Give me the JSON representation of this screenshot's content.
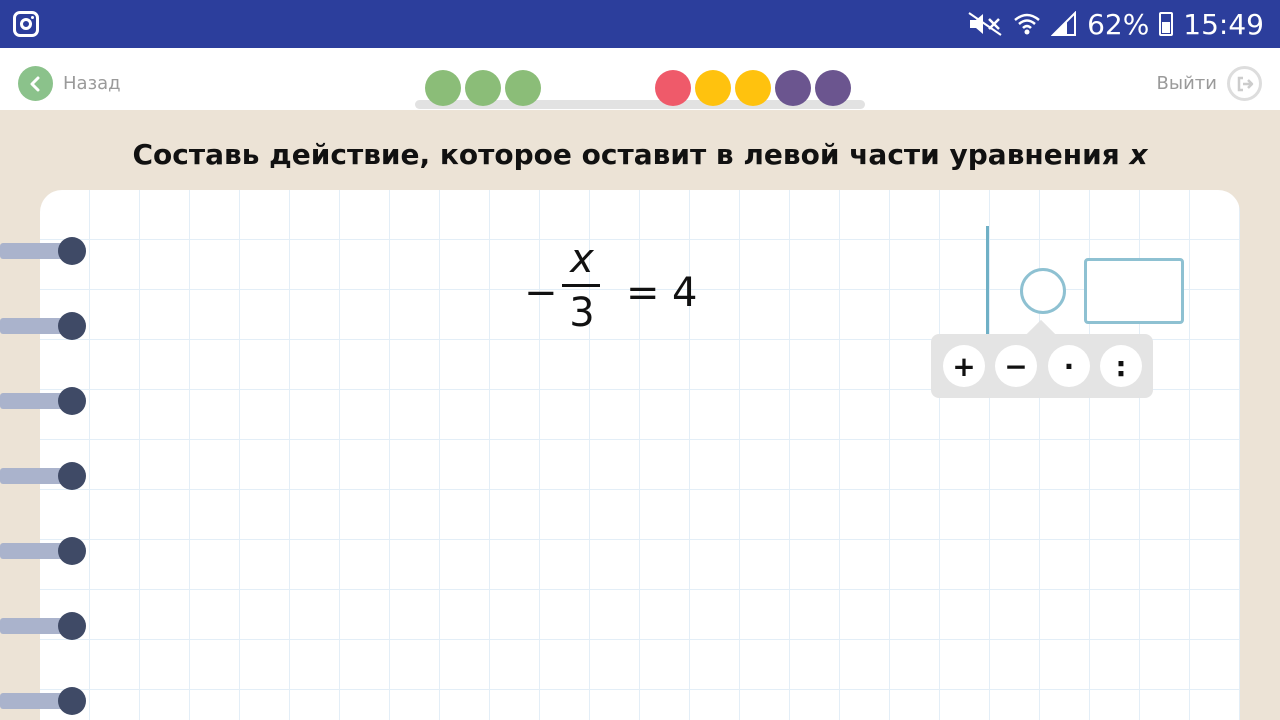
{
  "status_bar": {
    "battery_text": "62%",
    "time": "15:49",
    "icons": [
      "instagram-icon",
      "mute-icon",
      "wifi-icon",
      "signal-icon",
      "battery-icon"
    ]
  },
  "header": {
    "back_label": "Назад",
    "exit_label": "Выйти"
  },
  "progress": {
    "dots": [
      {
        "status": "done",
        "color": "#8bbd78"
      },
      {
        "status": "done",
        "color": "#8bbd78"
      },
      {
        "status": "done",
        "color": "#8bbd78"
      },
      {
        "status": "current",
        "color": "#ef5a6a"
      },
      {
        "status": "pending",
        "color": "#ffc20e"
      },
      {
        "status": "pending",
        "color": "#ffc20e"
      },
      {
        "status": "pending",
        "color": "#6b558f"
      },
      {
        "status": "pending",
        "color": "#6b558f"
      }
    ]
  },
  "task": {
    "title": "Составь действие, которое оставит в левой части уравнения",
    "title_var": "x"
  },
  "equation": {
    "sign": "−",
    "numerator": "x",
    "denominator": "3",
    "equals": "=",
    "rhs": "4"
  },
  "operations": {
    "plus": "+",
    "minus": "−",
    "multiply": "·",
    "divide": ":"
  },
  "colors": {
    "status_bar": "#2c3e9c",
    "background": "#ece3d6",
    "accent_outline": "#8ec1d2"
  }
}
